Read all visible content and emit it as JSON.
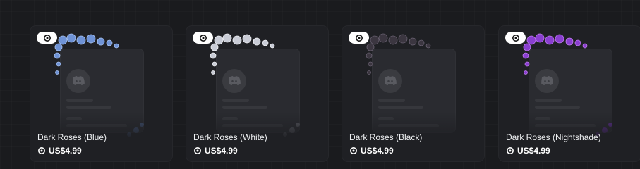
{
  "products": [
    {
      "name": "Dark Roses (Blue)",
      "price": "US$4.99",
      "badge_icon": "orb-icon",
      "accent": "#6f93d6",
      "accent2": "#a9c4f2"
    },
    {
      "name": "Dark Roses (White)",
      "price": "US$4.99",
      "badge_icon": "orb-icon",
      "accent": "#c9ccd6",
      "accent2": "#f2f3f7"
    },
    {
      "name": "Dark Roses (Black)",
      "price": "US$4.99",
      "badge_icon": "orb-icon",
      "accent": "#3b3640",
      "accent2": "#6a6272"
    },
    {
      "name": "Dark Roses (Nightshade)",
      "price": "US$4.99",
      "badge_icon": "orb-icon",
      "accent": "#8a3fd0",
      "accent2": "#c27cf2"
    }
  ]
}
